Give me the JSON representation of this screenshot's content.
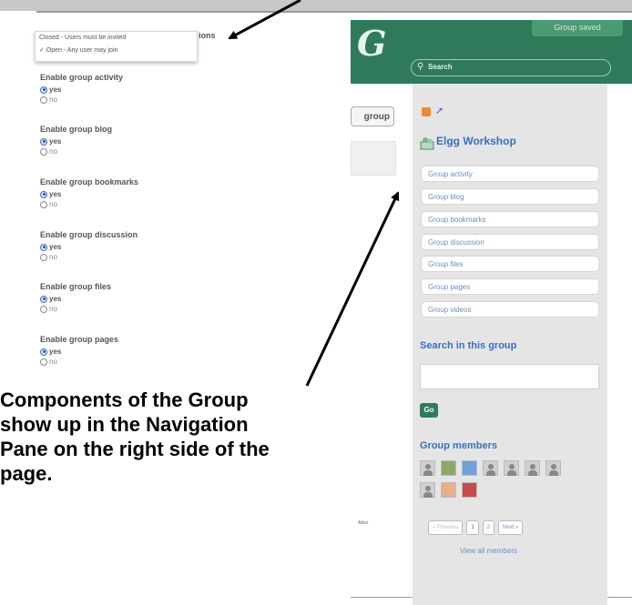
{
  "header": {
    "saved_label": "Group saved",
    "search_label": "Search"
  },
  "access_dropdown": {
    "options": [
      "Closed - Users must be invited",
      "✓ Open - Any user may join"
    ],
    "label": "ions"
  },
  "settings": [
    {
      "title": "Enable group activity",
      "yes": "yes",
      "no": "no"
    },
    {
      "title": "Enable group blog",
      "yes": "yes",
      "no": "no"
    },
    {
      "title": "Enable group bookmarks",
      "yes": "yes",
      "no": "no"
    },
    {
      "title": "Enable group discussion",
      "yes": "yes",
      "no": "no"
    },
    {
      "title": "Enable group files",
      "yes": "yes",
      "no": "no"
    },
    {
      "title": "Enable group pages",
      "yes": "yes",
      "no": "no"
    }
  ],
  "middle": {
    "group_button": "group",
    "fragment": "Attes"
  },
  "sidebar": {
    "group_name": "Elgg Workshop",
    "nav_items": [
      "Group activity",
      "Group blog",
      "Group bookmarks",
      "Group discussion",
      "Group files",
      "Group pages",
      "Group videos"
    ],
    "search_title": "Search in this group",
    "go_label": "Go",
    "members_title": "Group members",
    "pager": {
      "previous": "« Previous",
      "page1": "1",
      "page2": "2",
      "next": "Next »"
    },
    "view_all": "View all members"
  },
  "callout": {
    "text": "Components of the Group\nshow up in the Navigation\nPane on the right side of the\npage."
  },
  "colors": {
    "header_green": "#2f7a5a",
    "link_blue": "#3a6fc0",
    "pane_grey": "#e5e5e5"
  }
}
